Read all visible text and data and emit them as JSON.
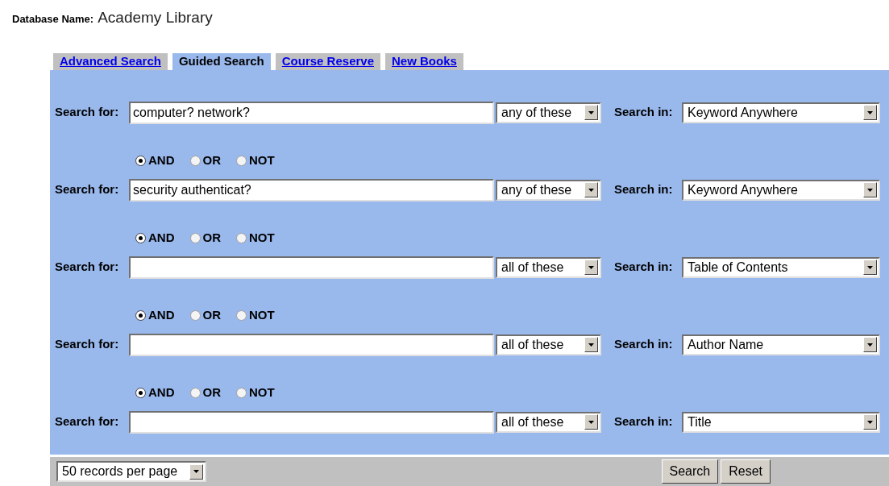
{
  "database": {
    "label": "Database Name:",
    "name": "Academy Library"
  },
  "tabs": [
    {
      "label": "Advanced Search",
      "selected": false
    },
    {
      "label": "Guided Search",
      "selected": true
    },
    {
      "label": "Course Reserve",
      "selected": false
    },
    {
      "label": "New Books",
      "selected": false
    }
  ],
  "rows": [
    {
      "label": "Search for:",
      "value": "computer? network?",
      "match": "any of these",
      "field_label": "Search in:",
      "field": "Keyword Anywhere"
    },
    {
      "operators": [
        {
          "label": "AND",
          "selected": true
        },
        {
          "label": "OR",
          "selected": false
        },
        {
          "label": "NOT",
          "selected": false
        }
      ],
      "label": "Search for:",
      "value": "security authenticat?",
      "match": "any of these",
      "field_label": "Search in:",
      "field": "Keyword Anywhere"
    },
    {
      "operators": [
        {
          "label": "AND",
          "selected": true
        },
        {
          "label": "OR",
          "selected": false
        },
        {
          "label": "NOT",
          "selected": false
        }
      ],
      "label": "Search for:",
      "value": "",
      "match": "all of these",
      "field_label": "Search in:",
      "field": "Table of Contents"
    },
    {
      "operators": [
        {
          "label": "AND",
          "selected": true
        },
        {
          "label": "OR",
          "selected": false
        },
        {
          "label": "NOT",
          "selected": false
        }
      ],
      "label": "Search for:",
      "value": "",
      "match": "all of these",
      "field_label": "Search in:",
      "field": "Author Name"
    },
    {
      "operators": [
        {
          "label": "AND",
          "selected": true
        },
        {
          "label": "OR",
          "selected": false
        },
        {
          "label": "NOT",
          "selected": false
        }
      ],
      "label": "Search for:",
      "value": "",
      "match": "all of these",
      "field_label": "Search in:",
      "field": "Title"
    }
  ],
  "footer": {
    "per_page": "50 records per page",
    "buttons": [
      "Search",
      "Reset"
    ]
  }
}
